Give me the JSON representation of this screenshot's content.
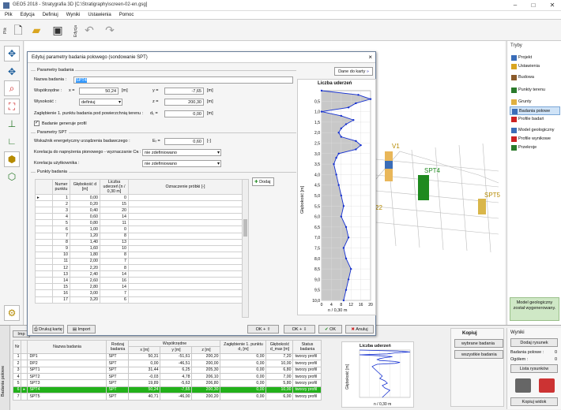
{
  "window": {
    "title": "GEO5 2018 - Stratygrafia 3D [C:\\Stratigraphy\\screen-02-en.gsg]"
  },
  "menu": [
    "Plik",
    "Edycja",
    "Definiuj",
    "Wyniki",
    "Ustawienia",
    "Pomoc"
  ],
  "toolbar": {
    "vertical_label": "Plik",
    "vertical_label2": "Edycja"
  },
  "dialog": {
    "title": "Edytuj parametry badania polowego (sondowanie SPT)",
    "close": "×",
    "dane_button": "Dane do karty",
    "section_param": "Parametry badania",
    "name_label": "Nazwa badania :",
    "name_value": "SPT4",
    "coord_label": "Współrzędne :",
    "x_label": "x =",
    "x_value": "50,24",
    "unit_m": "[m]",
    "y_label": "y =",
    "y_value": "-7,65",
    "wys_label": "Wysokość :",
    "wys_value": "definiuj",
    "z_label": "z =",
    "z_value": "200,30",
    "zag_label": "Zagłębienie 1. punktu badania pod powierzchnią terenu :",
    "d1_label": "d₁ =",
    "d1_value": "0,00",
    "check_label": "Badanie generuje profil",
    "section_spt": "Parametry SPT",
    "wsk_label": "Wskaźnik energetyczny urządzenia badawczego :",
    "er_label": "Eᵣ =",
    "er_value": "0,60",
    "er_unit": "[-]",
    "kor1_label": "Korelacja do naprężenia pionowego - wyznaczanie Cɴ :",
    "kor1_value": "nie zdefiniowano",
    "kor2_label": "Korelacja użytkownika :",
    "kor2_value": "nie zdefiniowano",
    "section_points": "Punkty badania",
    "add_button": "Dodaj",
    "col_num": "Numer punktu",
    "col_depth": "Głębokość d [m]",
    "col_count": "Liczba uderzeń [n / 0,30 m]",
    "col_mark": "Oznaczenie próbki [-]",
    "rows": [
      [
        "1",
        "0,00",
        "0"
      ],
      [
        "2",
        "0,20",
        "15"
      ],
      [
        "3",
        "0,40",
        "20"
      ],
      [
        "4",
        "0,60",
        "14"
      ],
      [
        "5",
        "0,80",
        "11"
      ],
      [
        "6",
        "1,00",
        "0"
      ],
      [
        "7",
        "1,20",
        "8"
      ],
      [
        "8",
        "1,40",
        "13"
      ],
      [
        "9",
        "1,60",
        "10"
      ],
      [
        "10",
        "1,80",
        "8"
      ],
      [
        "11",
        "2,00",
        "7"
      ],
      [
        "12",
        "2,20",
        "8"
      ],
      [
        "13",
        "2,40",
        "14"
      ],
      [
        "14",
        "2,60",
        "16"
      ],
      [
        "15",
        "2,80",
        "14"
      ],
      [
        "16",
        "3,00",
        "7"
      ],
      [
        "17",
        "3,20",
        "6"
      ]
    ],
    "print_button": "Drukuj kartę",
    "import_button": "Import",
    "ok_plus_up": "OK + ⇧",
    "ok_plus_down": "OK + ⇩",
    "ok_button": "OK",
    "cancel_button": "Anuluj"
  },
  "chart_data": {
    "type": "line",
    "title": "Liczba uderzeń",
    "ylabel": "Głębokość [m]",
    "xlabel": "n / 0,30 m",
    "xlim": [
      0,
      20
    ],
    "ylim": [
      0,
      10
    ],
    "x_ticks": [
      "0",
      "4",
      "8",
      "12",
      "16",
      "20"
    ],
    "y_ticks": [
      "0,5",
      "1,0",
      "1,5",
      "2,0",
      "2,5",
      "3,0",
      "3,5",
      "4,0",
      "4,5",
      "5,0",
      "5,5",
      "6,0",
      "6,5",
      "7,0",
      "7,5",
      "8,0",
      "8,5",
      "9,0",
      "9,5",
      "10,0"
    ],
    "depth": [
      0,
      0.2,
      0.4,
      0.6,
      0.8,
      1.0,
      1.2,
      1.4,
      1.6,
      1.8,
      2.0,
      2.2,
      2.4,
      2.6,
      2.8,
      3.0,
      3.2,
      3.5,
      4.0,
      4.5,
      5.0,
      5.5,
      6.0,
      6.5,
      7.0,
      7.5,
      8.0,
      8.5,
      9.0,
      9.5,
      10.0
    ],
    "values": [
      0,
      15,
      20,
      14,
      11,
      0,
      8,
      13,
      10,
      8,
      7,
      8,
      14,
      16,
      14,
      7,
      6,
      5,
      6,
      7,
      8,
      9,
      8,
      10,
      11,
      9,
      10,
      12,
      11,
      10,
      9
    ]
  },
  "right_panel": {
    "header": "Tryby",
    "items": [
      "Projekt",
      "Ustawienia",
      "Budowa",
      "Punkty terenu",
      "Grunty",
      "Badania polowe",
      "Profile badań",
      "Model geologiczny",
      "Profile wynikowe",
      "Przekroje"
    ],
    "geo_msg": "Model geologiczny został wygenerowany."
  },
  "scene": {
    "labels": [
      "V1",
      "SPT4",
      "SPT5",
      "22"
    ]
  },
  "bottom": {
    "side_label": "Badania polowe",
    "headers": [
      "Nr",
      "",
      "Nazwa badania",
      "Rodzaj badania",
      "x [m]",
      "y [m]",
      "z [m]",
      "Zagłębienie 1. punktu d₁ [m]",
      "Głębokość d_max [m]",
      "Status badania"
    ],
    "coord_header": "Współrzędne",
    "rows": [
      [
        "1",
        "",
        "DP1",
        "SPT",
        "50,31",
        "-51,61",
        "200,20",
        "0,00",
        "7,20",
        "tworzy profil"
      ],
      [
        "2",
        "",
        "DP2",
        "SPT",
        "0,00",
        "-46,51",
        "200,00",
        "0,00",
        "10,00",
        "tworzy profil"
      ],
      [
        "3",
        "",
        "SPT1",
        "SPT",
        "31,44",
        "6,25",
        "205,30",
        "0,00",
        "6,80",
        "tworzy profil"
      ],
      [
        "4",
        "",
        "SPT2",
        "SPT",
        "-0,03",
        "4,78",
        "206,10",
        "0,00",
        "7,00",
        "tworzy profil"
      ],
      [
        "5",
        "",
        "SPT3",
        "SPT",
        "19,89",
        "-5,63",
        "206,80",
        "0,00",
        "5,80",
        "tworzy profil"
      ],
      [
        "6",
        "",
        "SPT4",
        "SPT",
        "50,24",
        "-7,65",
        "200,30",
        "0,00",
        "10,00",
        "tworzy profil"
      ],
      [
        "7",
        "",
        "SPT5",
        "SPT",
        "40,71",
        "-46,00",
        "200,20",
        "0,00",
        "6,00",
        "tworzy profil"
      ]
    ],
    "highlight_row": 5,
    "mini_title": "Liczba uderzeń",
    "mini_ylabel": "Głębokość [m]",
    "mini_xlabel": "n / 0,30 m",
    "kopiuj": {
      "title": "Kopiuj",
      "btn1": "wybrane badania",
      "btn2": "wszystkie badania"
    },
    "wyniki": {
      "title": "Wyniki",
      "dodaj": "Dodaj rysunek",
      "badania_label": "Badania polowe :",
      "badania_val": "0",
      "ogolem_label": "Ogółem :",
      "ogolem_val": "0",
      "lista": "Lista rysunków",
      "kopia": "Kopiuj widok"
    }
  }
}
